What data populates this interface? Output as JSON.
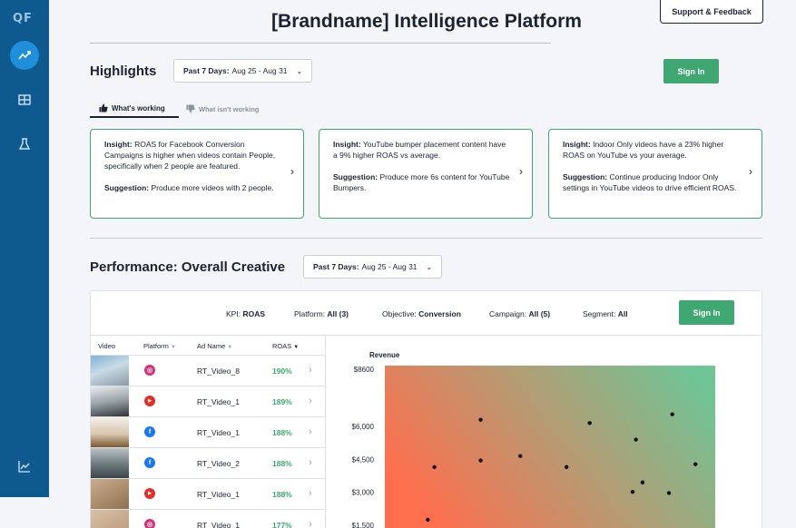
{
  "app": {
    "logo": "QF",
    "title": "[Brandname] Intelligence Platform",
    "support_label": "Support & Feedback"
  },
  "sidebar": {
    "items": [
      {
        "icon": "chart-line-icon",
        "active": true
      },
      {
        "icon": "table-icon",
        "active": false
      },
      {
        "icon": "flask-icon",
        "active": false
      },
      {
        "icon": "trend-icon",
        "active": false
      }
    ]
  },
  "highlights": {
    "title": "Highlights",
    "date_prefix": "Past 7 Days:",
    "date_range": "Aug 25 - Aug 31",
    "signin_label": "Sign In",
    "tabs": [
      {
        "label": "What's working",
        "icon": "thumbs-up-icon",
        "active": true
      },
      {
        "label": "What isn't working",
        "icon": "thumbs-down-icon",
        "active": false
      }
    ],
    "cards": [
      {
        "insight_label": "Insight:",
        "insight": "ROAS for Facebook Conversion Campaigns is higher when videos contain People, specifically when 2 people are featured.",
        "suggestion_label": "Suggestion:",
        "suggestion": "Produce more videos with 2 people."
      },
      {
        "insight_label": "Insight:",
        "insight": "YouTube bumper placement content have a 9% higher ROAS vs average.",
        "suggestion_label": "Suggestion:",
        "suggestion": "Produce more 6s content for YouTube Bumpers."
      },
      {
        "insight_label": "Insight:",
        "insight": "Indoor Only videos have a 23% higher ROAS on YouTube vs your average.",
        "suggestion_label": "Suggestion:",
        "suggestion": "Continue producing Indoor Only settings in YouTube videos to drive efficient ROAS."
      }
    ]
  },
  "performance": {
    "title": "Performance: Overall Creative",
    "date_prefix": "Past 7 Days:",
    "date_range": "Aug 25 - Aug 31",
    "signin_label": "Sign In",
    "filters": [
      {
        "label": "KPI:",
        "value": "ROAS"
      },
      {
        "label": "Platform:",
        "value": "All (3)"
      },
      {
        "label": "Objective:",
        "value": "Conversion"
      },
      {
        "label": "Campaign:",
        "value": "All (5)"
      },
      {
        "label": "Segment:",
        "value": "All"
      }
    ],
    "columns": [
      "Video",
      "Platform",
      "Ad Name",
      "ROAS"
    ],
    "rows": [
      {
        "platform": "instagram",
        "ad_name": "RT_Video_8",
        "roas": "190%"
      },
      {
        "platform": "youtube",
        "ad_name": "RT_Video_1",
        "roas": "189%"
      },
      {
        "platform": "facebook",
        "ad_name": "RT_Video_1",
        "roas": "188%"
      },
      {
        "platform": "facebook",
        "ad_name": "RT_Video_2",
        "roas": "188%"
      },
      {
        "platform": "youtube",
        "ad_name": "RT_Video_1",
        "roas": "188%"
      },
      {
        "platform": "instagram",
        "ad_name": "RT_Video_1",
        "roas": "177%"
      }
    ]
  },
  "chart_data": {
    "type": "scatter",
    "title": "",
    "ylabel": "Revenue",
    "xlabel": "",
    "yticks": [
      "$8600",
      "$6,000",
      "$4,500",
      "$3,000",
      "$1,500"
    ],
    "ytick_values": [
      8600,
      6000,
      4500,
      3000,
      1500
    ],
    "ylim": [
      1500,
      8600
    ],
    "gradient": [
      "#ff6f4e",
      "#6fc596"
    ],
    "points": [
      {
        "x": 0.15,
        "y": 4150
      },
      {
        "x": 0.29,
        "y": 6300
      },
      {
        "x": 0.29,
        "y": 4450
      },
      {
        "x": 0.41,
        "y": 4650
      },
      {
        "x": 0.55,
        "y": 4150
      },
      {
        "x": 0.62,
        "y": 6150
      },
      {
        "x": 0.76,
        "y": 5400
      },
      {
        "x": 0.87,
        "y": 6550
      },
      {
        "x": 0.78,
        "y": 3450
      },
      {
        "x": 0.94,
        "y": 4280
      },
      {
        "x": 0.75,
        "y": 3020
      },
      {
        "x": 0.86,
        "y": 2970
      },
      {
        "x": 0.13,
        "y": 1750
      }
    ]
  },
  "colors": {
    "sidebar": "#0e5a8f",
    "accent_green": "#3ea772",
    "active_nav": "#1e8fd8",
    "instagram": "#d6317a",
    "youtube": "#e52d27",
    "facebook": "#1877f2"
  }
}
